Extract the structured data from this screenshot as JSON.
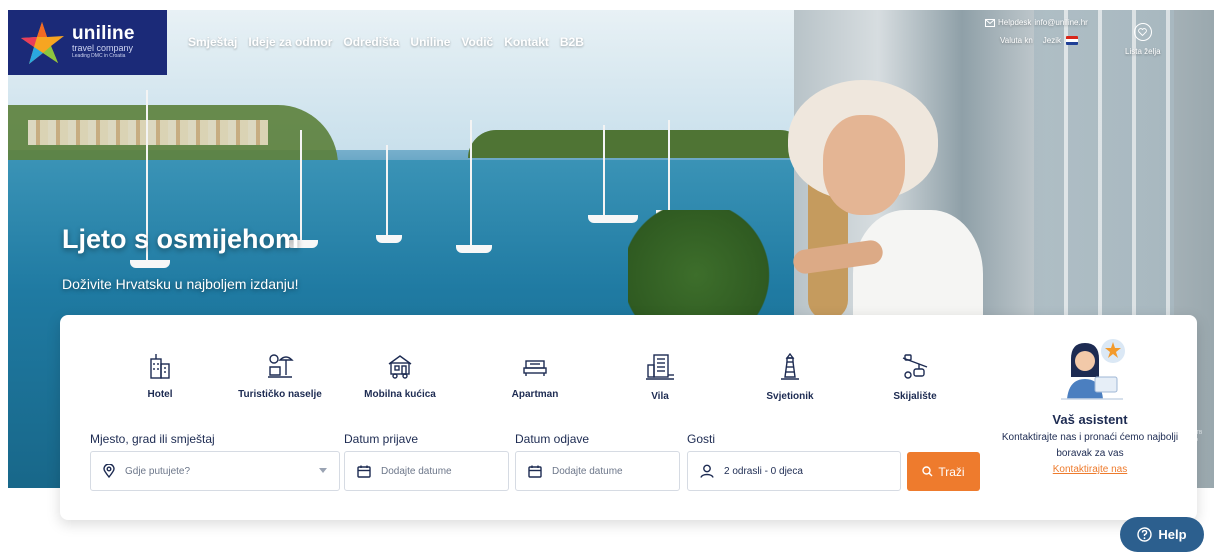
{
  "logo": {
    "name": "uniline",
    "subtitle": "travel company",
    "tagline": "Leading DMC in Croatia"
  },
  "nav": {
    "items": [
      "Smještaj",
      "Ideje za odmor",
      "Odredišta",
      "Uniline",
      "Vodič",
      "Kontakt",
      "B2B"
    ]
  },
  "top_bar": {
    "helpdesk_label": "Helpdesk",
    "helpdesk_email": "info@uniline.hr",
    "currency_label": "Valuta",
    "currency_value": "kn",
    "language_label": "Jezik",
    "wishlist_label": "Lista želja"
  },
  "hero": {
    "title": "Ljeto s osmijehom",
    "subtitle": "Doživite Hrvatsku u najboljem izdanju!"
  },
  "photo_credit": {
    "source": "Source: CNTB",
    "author": "Author: Hrvo"
  },
  "types": [
    {
      "label": "Hotel",
      "icon": "hotel-icon"
    },
    {
      "label": "Turističko naselje",
      "icon": "resort-icon"
    },
    {
      "label": "Mobilna kućica",
      "icon": "mobile-home-icon"
    },
    {
      "label": "Apartman",
      "icon": "apartment-icon"
    },
    {
      "label": "Vila",
      "icon": "villa-icon"
    },
    {
      "label": "Svjetionik",
      "icon": "lighthouse-icon"
    },
    {
      "label": "Skijalište",
      "icon": "ski-lift-icon"
    }
  ],
  "search": {
    "destination_label": "Mjesto, grad ili smještaj",
    "destination_placeholder": "Gdje putujete?",
    "checkin_label": "Datum prijave",
    "checkin_placeholder": "Dodajte datume",
    "checkout_label": "Datum odjave",
    "checkout_placeholder": "Dodajte datume",
    "guests_label": "Gosti",
    "guests_value": "2 odrasli - 0 djeca",
    "button_label": "Traži"
  },
  "assistant": {
    "title": "Vaš asistent",
    "text": "Kontaktirajte nas i pronaći ćemo najbolji boravak za vas",
    "link": "Kontaktirajte nas"
  },
  "help": {
    "label": "Help"
  },
  "colors": {
    "brand_navy": "#1b2a78",
    "accent_orange": "#ee7b2d",
    "text_dark": "#1d2b52",
    "help_blue": "#2c5f8e"
  }
}
